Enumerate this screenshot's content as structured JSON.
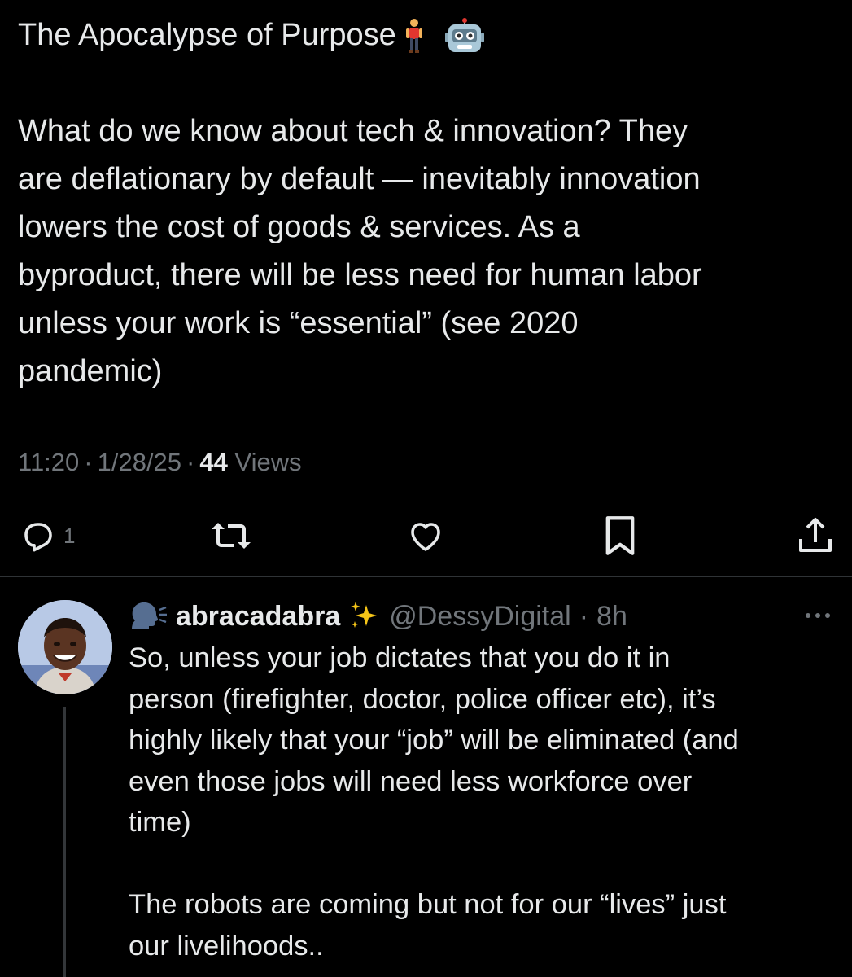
{
  "tweet": {
    "title": "The Apocalypse of Purpose",
    "title_emojis": [
      "man-standing-emoji",
      "robot-emoji"
    ],
    "body_lines": [
      "What do we know about tech & innovation? They",
      "are deflationary by default — inevitably innovation",
      "lowers the cost of goods & services. As a",
      "byproduct, there will be less need for human labor",
      "unless your work is “essential” (see 2020",
      "pandemic)"
    ],
    "time": "11:20",
    "date": "1/28/25",
    "views_count": "44",
    "views_label": "Views",
    "separator": "·"
  },
  "actions": {
    "reply_count": "1",
    "icons": [
      "reply-icon",
      "retweet-icon",
      "like-icon",
      "bookmark-icon",
      "share-icon"
    ]
  },
  "reply": {
    "name_prefix_emoji": "speaking-head-emoji",
    "display_name": "abracadabra",
    "name_suffix_emoji": "sparkles-emoji",
    "handle": "@DessyDigital",
    "separator": "·",
    "time": "8h",
    "body_lines": [
      "So, unless your job dictates that you do it in",
      "person (firefighter, doctor, police officer etc), it’s",
      "highly likely that your “job” will be eliminated (and",
      "even those jobs will need less workforce over",
      "time)",
      "",
      "The robots are coming but not for our “lives” just",
      "our livelihoods.."
    ]
  },
  "colors": {
    "background": "#000000",
    "text": "#e7e9ea",
    "secondary": "#71767b",
    "divider": "#2f3336"
  }
}
